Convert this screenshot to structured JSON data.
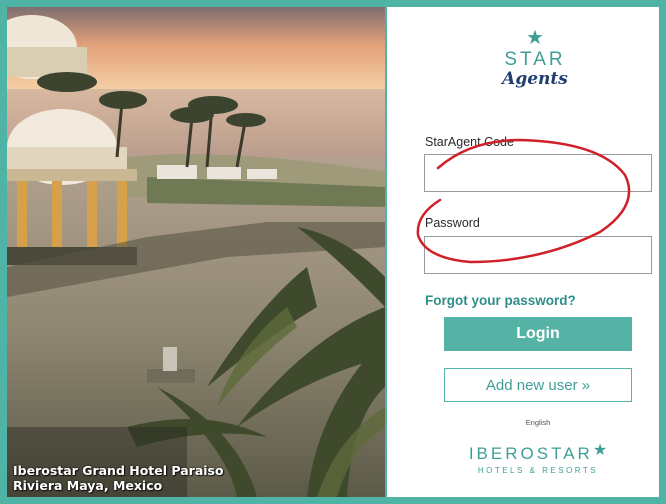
{
  "photo": {
    "caption_line1": "Iberostar Grand Hotel Paraiso",
    "caption_line2": "Riviera Maya, Mexico"
  },
  "logo": {
    "star": "★",
    "brand": "STAR",
    "script": "Agents"
  },
  "form": {
    "code_label": "StarAgent Code",
    "code_value": "",
    "password_label": "Password",
    "password_value": "",
    "forgot_link": "Forgot your password?",
    "login_button": "Login",
    "add_user_button": "Add new user »",
    "language": "English"
  },
  "footer_logo": {
    "name": "IBEROSTAR",
    "star": "★",
    "tagline": "HOTELS & RESORTS"
  },
  "colors": {
    "teal_border": "#4fb3a6",
    "button_teal": "#54b3a5",
    "link_teal": "#2f8f88",
    "annotation_red": "#d0202a"
  }
}
